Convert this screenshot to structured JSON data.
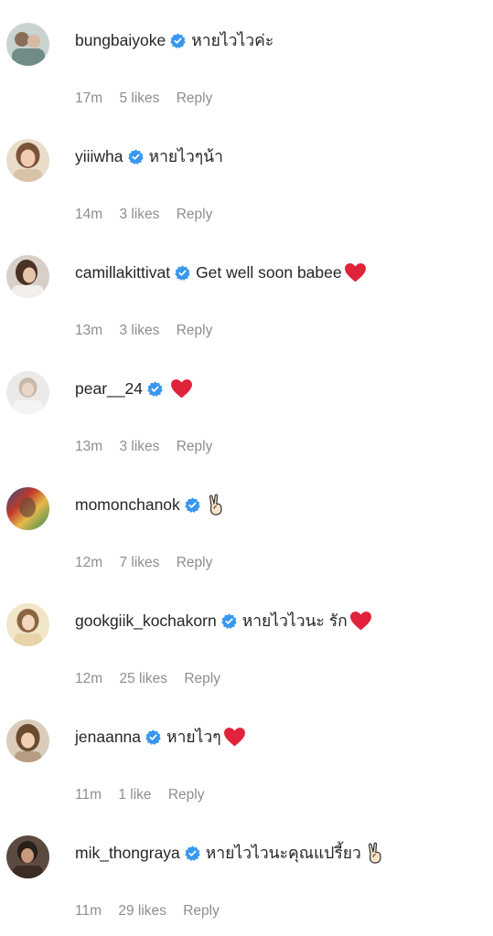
{
  "comments": [
    {
      "username": "bungbaiyoke",
      "text": "หายไวไวค่ะ",
      "emoji": "",
      "time": "17m",
      "likes": "5 likes",
      "reply": "Reply",
      "avatar": "avatar-1"
    },
    {
      "username": "yiiiwha",
      "text": "หายไวๆน้า",
      "emoji": "",
      "time": "14m",
      "likes": "3 likes",
      "reply": "Reply",
      "avatar": "avatar-2"
    },
    {
      "username": "camillakittivat",
      "text": "Get well soon babee",
      "emoji": "heart",
      "time": "13m",
      "likes": "3 likes",
      "reply": "Reply",
      "avatar": "avatar-3"
    },
    {
      "username": "pear__24",
      "text": "",
      "emoji": "heart",
      "time": "13m",
      "likes": "3 likes",
      "reply": "Reply",
      "avatar": "avatar-4"
    },
    {
      "username": "momonchanok",
      "text": "",
      "emoji": "victory-hand",
      "time": "12m",
      "likes": "7 likes",
      "reply": "Reply",
      "avatar": "avatar-5"
    },
    {
      "username": "gookgiik_kochakorn",
      "text": "หายไวไวนะ รัก",
      "emoji": "heart",
      "time": "12m",
      "likes": "25 likes",
      "reply": "Reply",
      "avatar": "avatar-6"
    },
    {
      "username": "jenaanna",
      "text": "หายไวๆ",
      "emoji": "heart",
      "time": "11m",
      "likes": "1 like",
      "reply": "Reply",
      "avatar": "avatar-7"
    },
    {
      "username": "mik_thongraya",
      "text": "หายไวไวนะคุณแปรี้ยว",
      "emoji": "victory-hand",
      "time": "11m",
      "likes": "29 likes",
      "reply": "Reply",
      "avatar": "avatar-8"
    }
  ],
  "colors": {
    "verified_blue": "#3897f0",
    "heart_red": "#e0223a",
    "meta_gray": "#8e8e8e",
    "text_dark": "#262626"
  }
}
